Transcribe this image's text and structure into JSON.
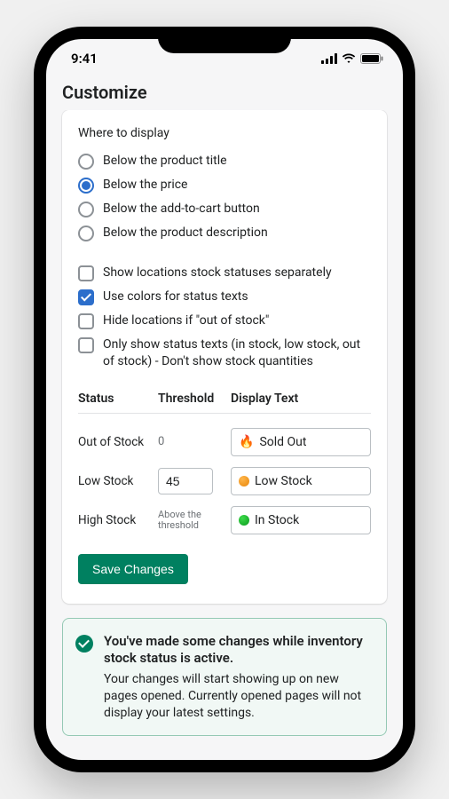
{
  "status_bar": {
    "time": "9:41"
  },
  "header": {
    "title": "Customize"
  },
  "display_location": {
    "label": "Where to display",
    "options": [
      {
        "label": "Below the product title",
        "checked": false
      },
      {
        "label": "Below the price",
        "checked": true
      },
      {
        "label": "Below the add-to-cart button",
        "checked": false
      },
      {
        "label": "Below the product description",
        "checked": false
      }
    ]
  },
  "options": [
    {
      "label": "Show locations stock statuses separately",
      "checked": false
    },
    {
      "label": "Use colors for status texts",
      "checked": true
    },
    {
      "label": "Hide locations if \"out of stock\"",
      "checked": false
    },
    {
      "label": "Only show status texts (in stock, low stock, out of stock) - Don't show stock quantities",
      "checked": false
    }
  ],
  "table": {
    "headers": {
      "status": "Status",
      "threshold": "Threshold",
      "display": "Display Text"
    },
    "rows": [
      {
        "status": "Out of Stock",
        "threshold": "0",
        "threshold_editable": false,
        "display_icon": "🔥",
        "display_text": "Sold Out",
        "dot": null
      },
      {
        "status": "Low Stock",
        "threshold": "45",
        "threshold_editable": true,
        "display_icon": null,
        "display_text": "Low Stock",
        "dot": "orange"
      },
      {
        "status": "High Stock",
        "threshold": "Above the threshold",
        "threshold_editable": false,
        "threshold_sub": true,
        "display_icon": null,
        "display_text": "In Stock",
        "dot": "green"
      }
    ]
  },
  "save_button": "Save Changes",
  "banner": {
    "title": "You've made some changes while inventory stock status is active.",
    "body": "Your changes will start showing up on new pages opened. Currently opened pages will not display your latest settings."
  }
}
